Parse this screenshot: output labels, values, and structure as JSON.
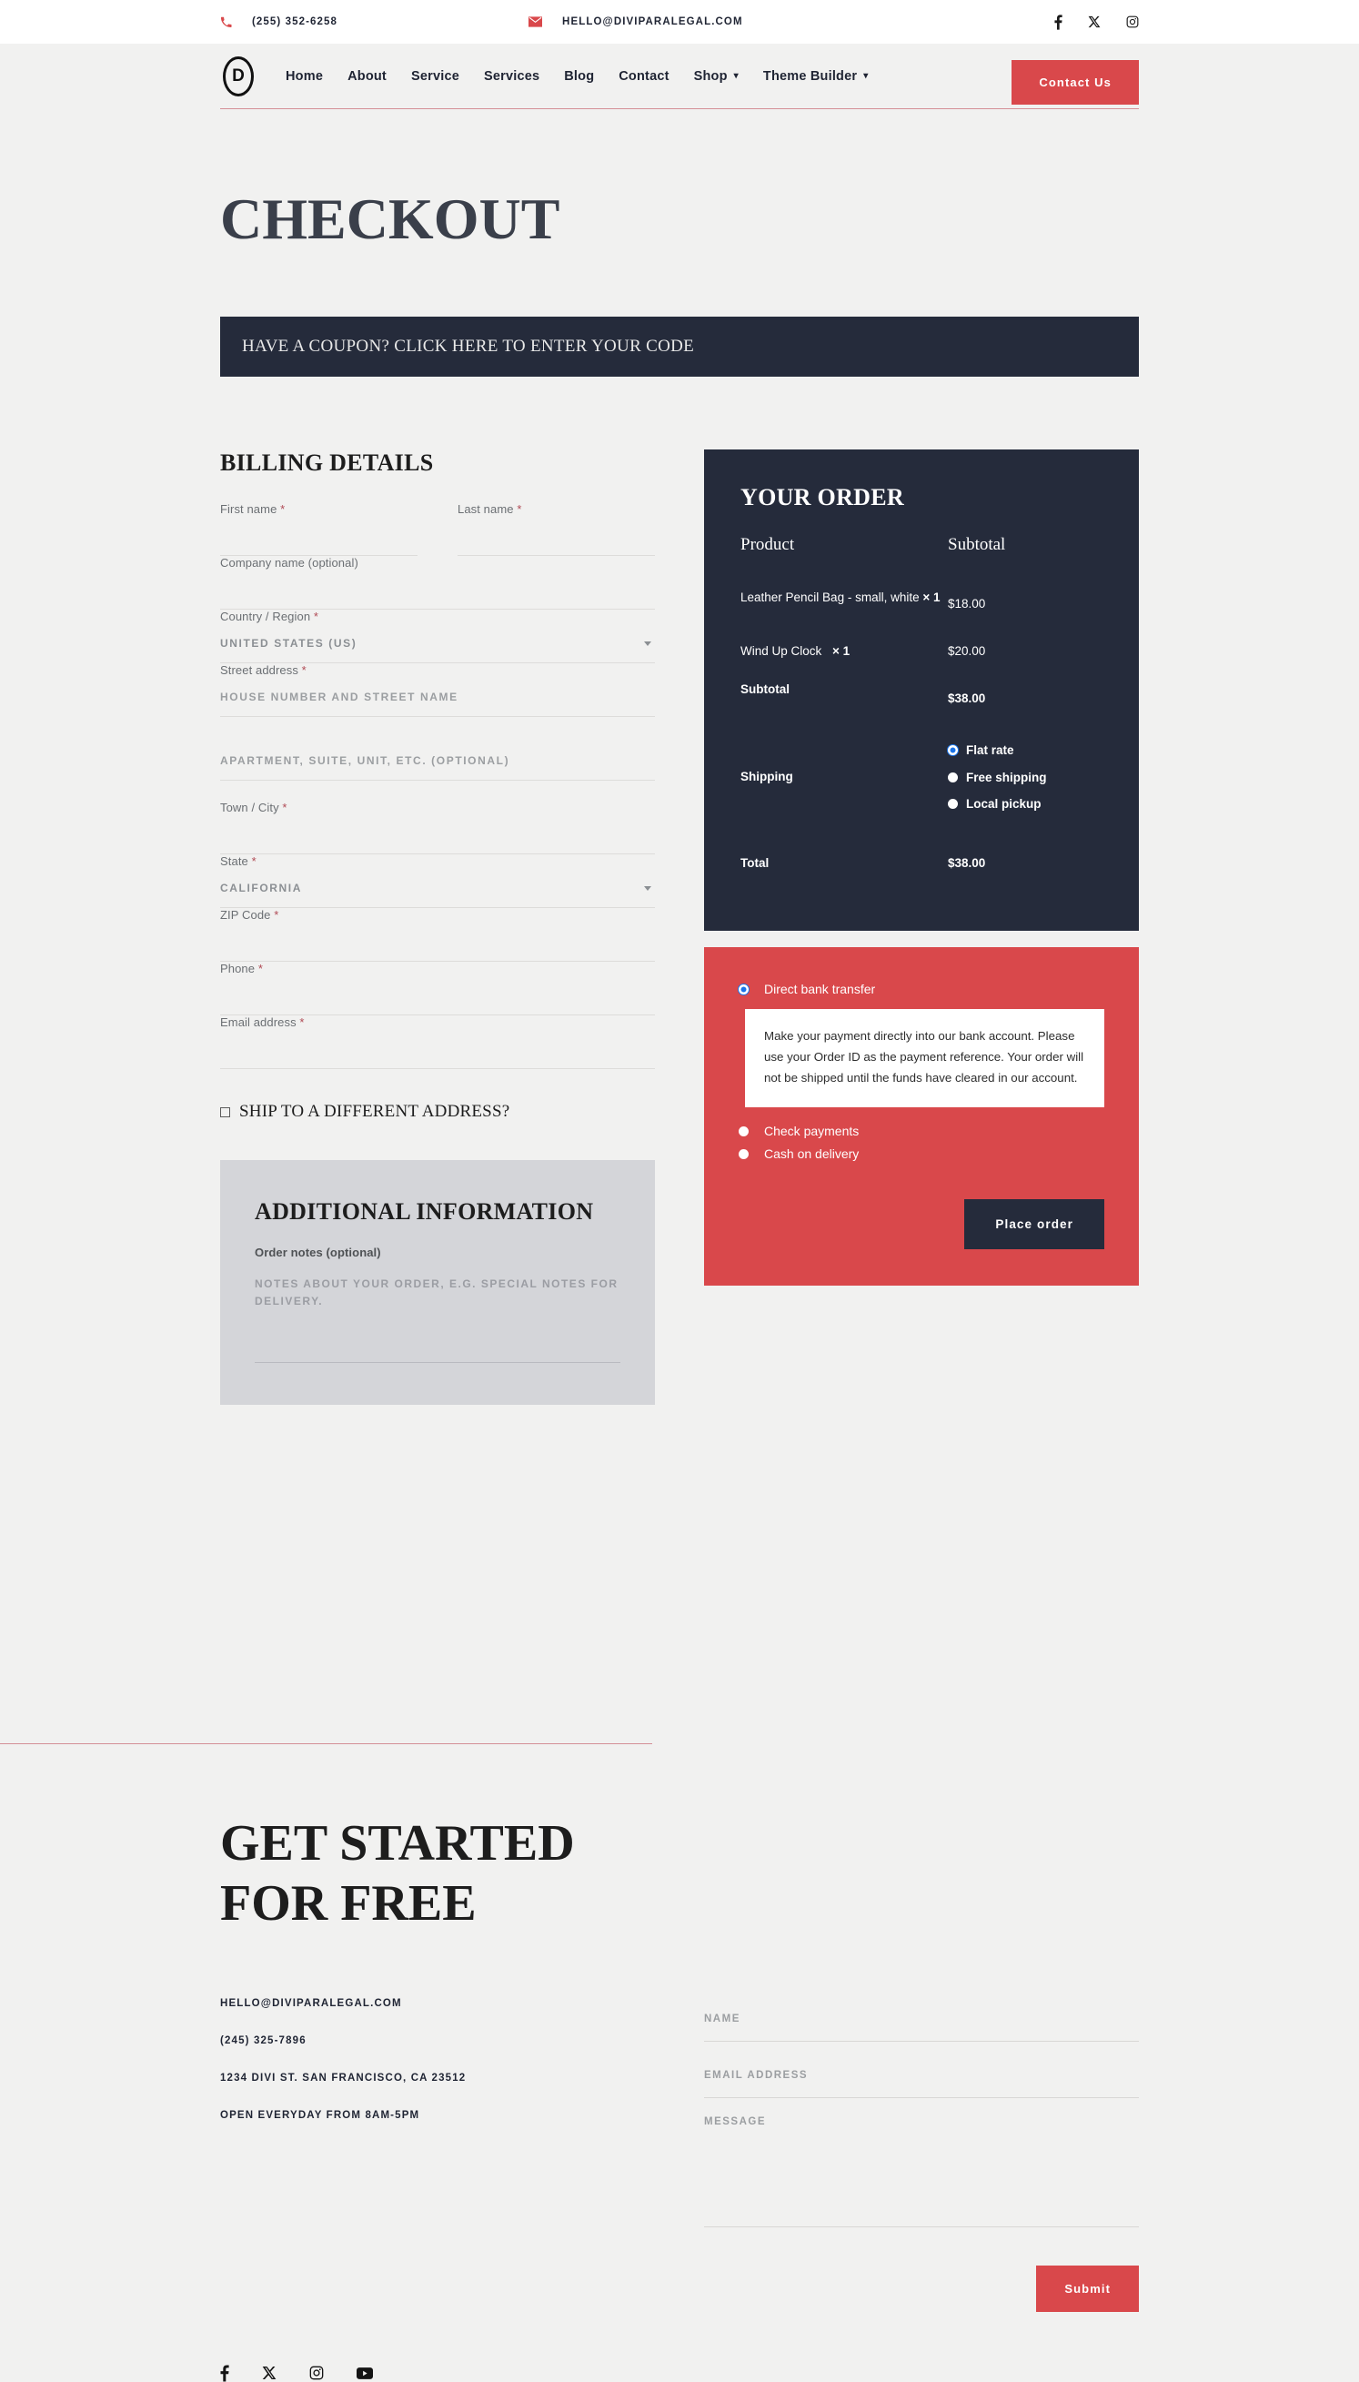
{
  "topbar": {
    "phone": "(255) 352-6258",
    "email": "HELLO@DIVIPARALEGAL.COM",
    "phone_icon": "phone-icon",
    "email_icon": "envelope-icon",
    "social": [
      "facebook-icon",
      "x-twitter-icon",
      "instagram-icon"
    ]
  },
  "nav": {
    "logo_letter": "D",
    "links": [
      {
        "label": "Home",
        "caret": false
      },
      {
        "label": "About",
        "caret": false
      },
      {
        "label": "Service",
        "caret": false
      },
      {
        "label": "Services",
        "caret": false
      },
      {
        "label": "Blog",
        "caret": false
      },
      {
        "label": "Contact",
        "caret": false
      },
      {
        "label": "Shop",
        "caret": true
      },
      {
        "label": "Theme Builder",
        "caret": true
      }
    ],
    "cta": "Contact Us"
  },
  "page": {
    "title": "CHECKOUT",
    "coupon_bar": "HAVE A COUPON? CLICK HERE TO ENTER YOUR CODE"
  },
  "billing": {
    "heading": "BILLING DETAILS",
    "first_name": {
      "label": "First name",
      "required": "*",
      "value": "",
      "placeholder": ""
    },
    "last_name": {
      "label": "Last name",
      "required": "*",
      "value": "",
      "placeholder": ""
    },
    "company": {
      "label": "Company name (optional)",
      "value": "",
      "placeholder": ""
    },
    "country": {
      "label": "Country / Region",
      "required": "*",
      "value": "UNITED STATES (US)"
    },
    "street": {
      "label": "Street address",
      "required": "*",
      "value": "",
      "placeholder": "House number and street name"
    },
    "street2": {
      "value": "",
      "placeholder": "Apartment, suite, unit, etc. (optional)"
    },
    "city": {
      "label": "Town / City",
      "required": "*",
      "value": "",
      "placeholder": ""
    },
    "state": {
      "label": "State",
      "required": "*",
      "value": "CALIFORNIA"
    },
    "zip": {
      "label": "ZIP Code",
      "required": "*",
      "value": "",
      "placeholder": ""
    },
    "phone": {
      "label": "Phone",
      "required": "*",
      "value": "",
      "placeholder": ""
    },
    "email": {
      "label": "Email address",
      "required": "*",
      "value": "",
      "placeholder": ""
    },
    "ship_different": "SHIP TO A DIFFERENT ADDRESS?"
  },
  "additional": {
    "heading": "ADDITIONAL INFORMATION",
    "notes_label": "Order notes (optional)",
    "notes_value": "",
    "notes_placeholder": "Notes about your order, e.g. special notes for delivery."
  },
  "order": {
    "heading": "YOUR ORDER",
    "col_product": "Product",
    "col_subtotal": "Subtotal",
    "items": [
      {
        "name": "Leather Pencil Bag - small, white",
        "qty": "× 1",
        "price": "$18.00"
      },
      {
        "name": "Wind Up Clock",
        "qty": "× 1",
        "price": "$20.00"
      }
    ],
    "subtotal_label": "Subtotal",
    "subtotal_value": "$38.00",
    "shipping_label": "Shipping",
    "shipping_options": [
      {
        "label": "Flat rate",
        "selected": true
      },
      {
        "label": "Free shipping",
        "selected": false
      },
      {
        "label": "Local pickup",
        "selected": false
      }
    ],
    "total_label": "Total",
    "total_value": "$38.00"
  },
  "payment": {
    "options": [
      {
        "label": "Direct bank transfer",
        "selected": true
      },
      {
        "label": "Check payments",
        "selected": false
      },
      {
        "label": "Cash on delivery",
        "selected": false
      }
    ],
    "bank_note": "Make your payment directly into our bank account. Please use your Order ID as the payment reference. Your order will not be shipped until the funds have cleared in our account.",
    "place_order": "Place order"
  },
  "footer": {
    "title": "GET STARTED FOR FREE",
    "email": "HELLO@DIVIPARALEGAL.COM",
    "phone": "(245) 325-7896",
    "address": "1234 DIVI ST. SAN FRANCISCO, CA 23512",
    "hours": "OPEN EVERYDAY FROM 8AM-5PM",
    "form": {
      "name_placeholder": "Name",
      "name_value": "",
      "email_placeholder": "Email Address",
      "email_value": "",
      "message_placeholder": "Message",
      "message_value": "",
      "submit": "Submit"
    },
    "social": [
      "facebook-icon",
      "x-twitter-icon",
      "instagram-icon",
      "youtube-icon"
    ]
  },
  "colors": {
    "accent_red": "#d9484b",
    "navy": "#252b3b",
    "page_bg": "#f1f1f0",
    "panel_gray": "#d4d5d9",
    "rule_pink": "#d48f96",
    "radio_blue": "#1a73e8"
  }
}
